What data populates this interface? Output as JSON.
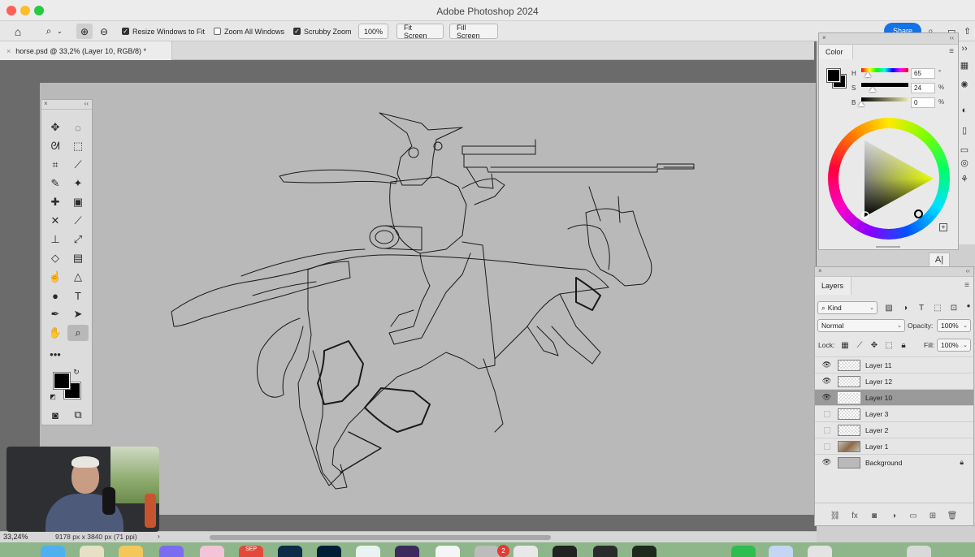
{
  "window": {
    "title": "Adobe Photoshop 2024"
  },
  "options_bar": {
    "resize_windows_label": "Resize Windows to Fit",
    "resize_windows_checked": true,
    "zoom_all_label": "Zoom All Windows",
    "zoom_all_checked": false,
    "scrubby_zoom_label": "Scrubby Zoom",
    "scrubby_zoom_checked": true,
    "zoom_value": "100%",
    "fit_screen_label": "Fit Screen",
    "fill_screen_label": "Fill Screen",
    "share_label": "Share"
  },
  "document": {
    "tab_label": "horse.psd @ 33,2% (Layer 10, RGB/8) *"
  },
  "color_panel": {
    "tab_label": "Color",
    "h_label": "H",
    "h_value": "65",
    "h_unit": "°",
    "s_label": "S",
    "s_value": "24",
    "s_unit": "%",
    "b_label": "B",
    "b_value": "0",
    "b_unit": "%"
  },
  "layers_panel": {
    "tab_label": "Layers",
    "filter_kind": "Kind",
    "blend_mode": "Normal",
    "opacity_label": "Opacity:",
    "opacity_value": "100%",
    "lock_label": "Lock:",
    "fill_label": "Fill:",
    "fill_value": "100%",
    "layers": [
      {
        "name": "Layer 11",
        "visible": true,
        "selected": false
      },
      {
        "name": "Layer 12",
        "visible": true,
        "selected": false
      },
      {
        "name": "Layer 10",
        "visible": true,
        "selected": true
      },
      {
        "name": "Layer 3",
        "visible": false,
        "selected": false
      },
      {
        "name": "Layer 2",
        "visible": false,
        "selected": false
      },
      {
        "name": "Layer 1",
        "visible": false,
        "selected": false
      },
      {
        "name": "Background",
        "visible": true,
        "selected": false,
        "locked": true
      }
    ]
  },
  "status_bar": {
    "zoom": "33,24%",
    "doc_info": "9178 px x 3840 px (71 ppi)"
  },
  "dock": {
    "badge_count": "2",
    "calendar_label": "SEP"
  }
}
